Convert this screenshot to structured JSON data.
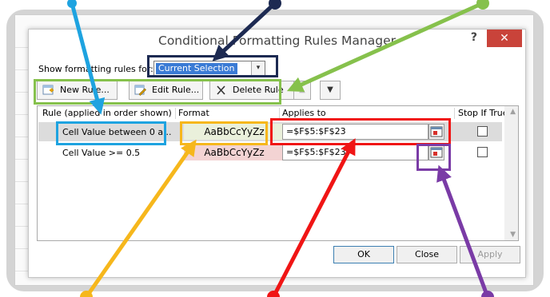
{
  "dialog": {
    "title": "Conditional Formatting Rules Manager",
    "help": "?",
    "close": "✕",
    "show_label": "Show formatting rules for:",
    "show_value": "Current Selection",
    "dropdown_arrow": "▾"
  },
  "toolbar": {
    "new_rule": "New Rule...",
    "edit_rule": "Edit Rule...",
    "delete_rule": "Delete Rule",
    "move_up": "▲",
    "move_down": "▼"
  },
  "grid": {
    "headers": [
      "Rule (applied in order shown)",
      "Format",
      "Applies to",
      "Stop If True"
    ],
    "rows": [
      {
        "rule": "Cell Value between 0 a...",
        "format": "AaBbCcYyZz",
        "applies": "=$F$5:$F$23"
      },
      {
        "rule": "Cell Value >= 0.5",
        "format": "AaBbCcYyZz",
        "applies": "=$F$5:$F$23"
      }
    ],
    "scroll_up": "▲",
    "scroll_down": "▼"
  },
  "footer": {
    "ok": "OK",
    "close": "Close",
    "apply": "Apply"
  },
  "colors": {
    "cyan": "#1ea3e0",
    "navy": "#1d2a52",
    "green": "#86c14c",
    "yellow": "#f6b71c",
    "red": "#f01515",
    "purple": "#7a3ba6",
    "format_green": "#eaf0db",
    "format_red": "#f3d3d3"
  },
  "icons": [
    "new-rule-icon",
    "edit-rule-icon",
    "delete-icon",
    "collapse-range-icon",
    "help-icon",
    "close-icon"
  ]
}
